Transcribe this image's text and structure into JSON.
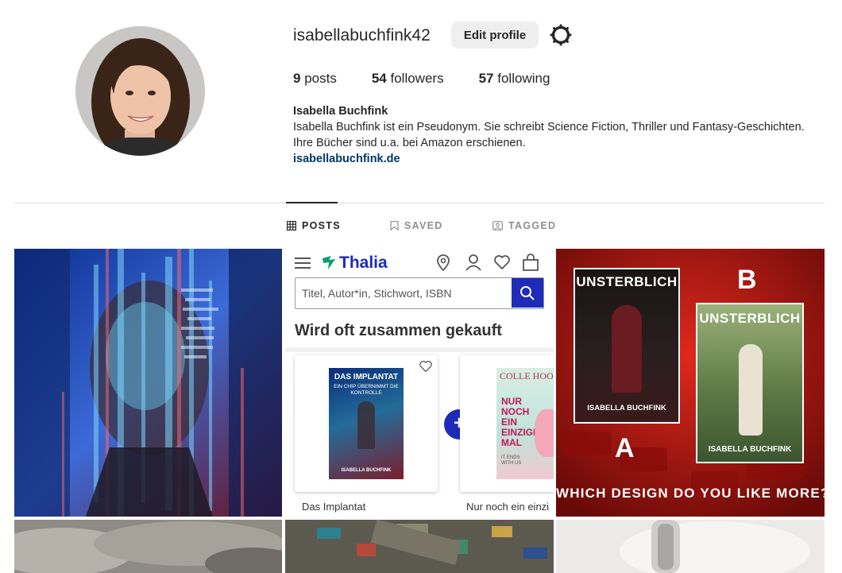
{
  "profile": {
    "username": "isabellabuchfink42",
    "edit_profile_label": "Edit profile",
    "posts_count": "9",
    "posts_label": "posts",
    "followers_count": "54",
    "followers_label": "followers",
    "following_count": "57",
    "following_label": "following",
    "name": "Isabella Buchfink",
    "bio_line1": "Isabella Buchfink ist ein Pseudonym. Sie schreibt Science Fiction, Thriller und Fantasy-Geschichten.",
    "bio_line2": "Ihre Bücher sind u.a. bei Amazon erschienen.",
    "website": "isabellabuchfink.de"
  },
  "tabs": [
    {
      "label": "POSTS",
      "icon": "grid-icon",
      "active": true
    },
    {
      "label": "SAVED",
      "icon": "bookmark-icon",
      "active": false
    },
    {
      "label": "TAGGED",
      "icon": "tag-user-icon",
      "active": false
    }
  ],
  "posts": {
    "thalia": {
      "brand": "Thalia",
      "search_placeholder": "Titel, Autor*in, Stichwort, ISBN",
      "heading": "Wird oft zusammen gekauft",
      "book1_title": "DAS IMPLANTAT",
      "book1_subtitle": "EIN CHIP ÜBERNIMMT DIE KONTROLLE",
      "book1_author": "ISABELLA BUCHFINK",
      "book1_caption": "Das Implantat",
      "book2_caption": "Nur noch ein einzi",
      "book2_author_fragment": "COLLE HOOVE",
      "book2_title": "NUR NOCH EIN EINZIGES MAL",
      "book2_tagline": "IT ENDS WITH US"
    },
    "cover_poll": {
      "label_a": "A",
      "label_b": "B",
      "cover_title": "UNSTERBLICH",
      "cover_author": "ISABELLA BUCHFINK",
      "question": "WHICH DESIGN DO YOU LIKE MORE?"
    }
  },
  "colors": {
    "link": "#00376b",
    "thalia_green": "#00a073",
    "thalia_blue": "#1d2bb8",
    "poll_red": "#c81a12"
  }
}
